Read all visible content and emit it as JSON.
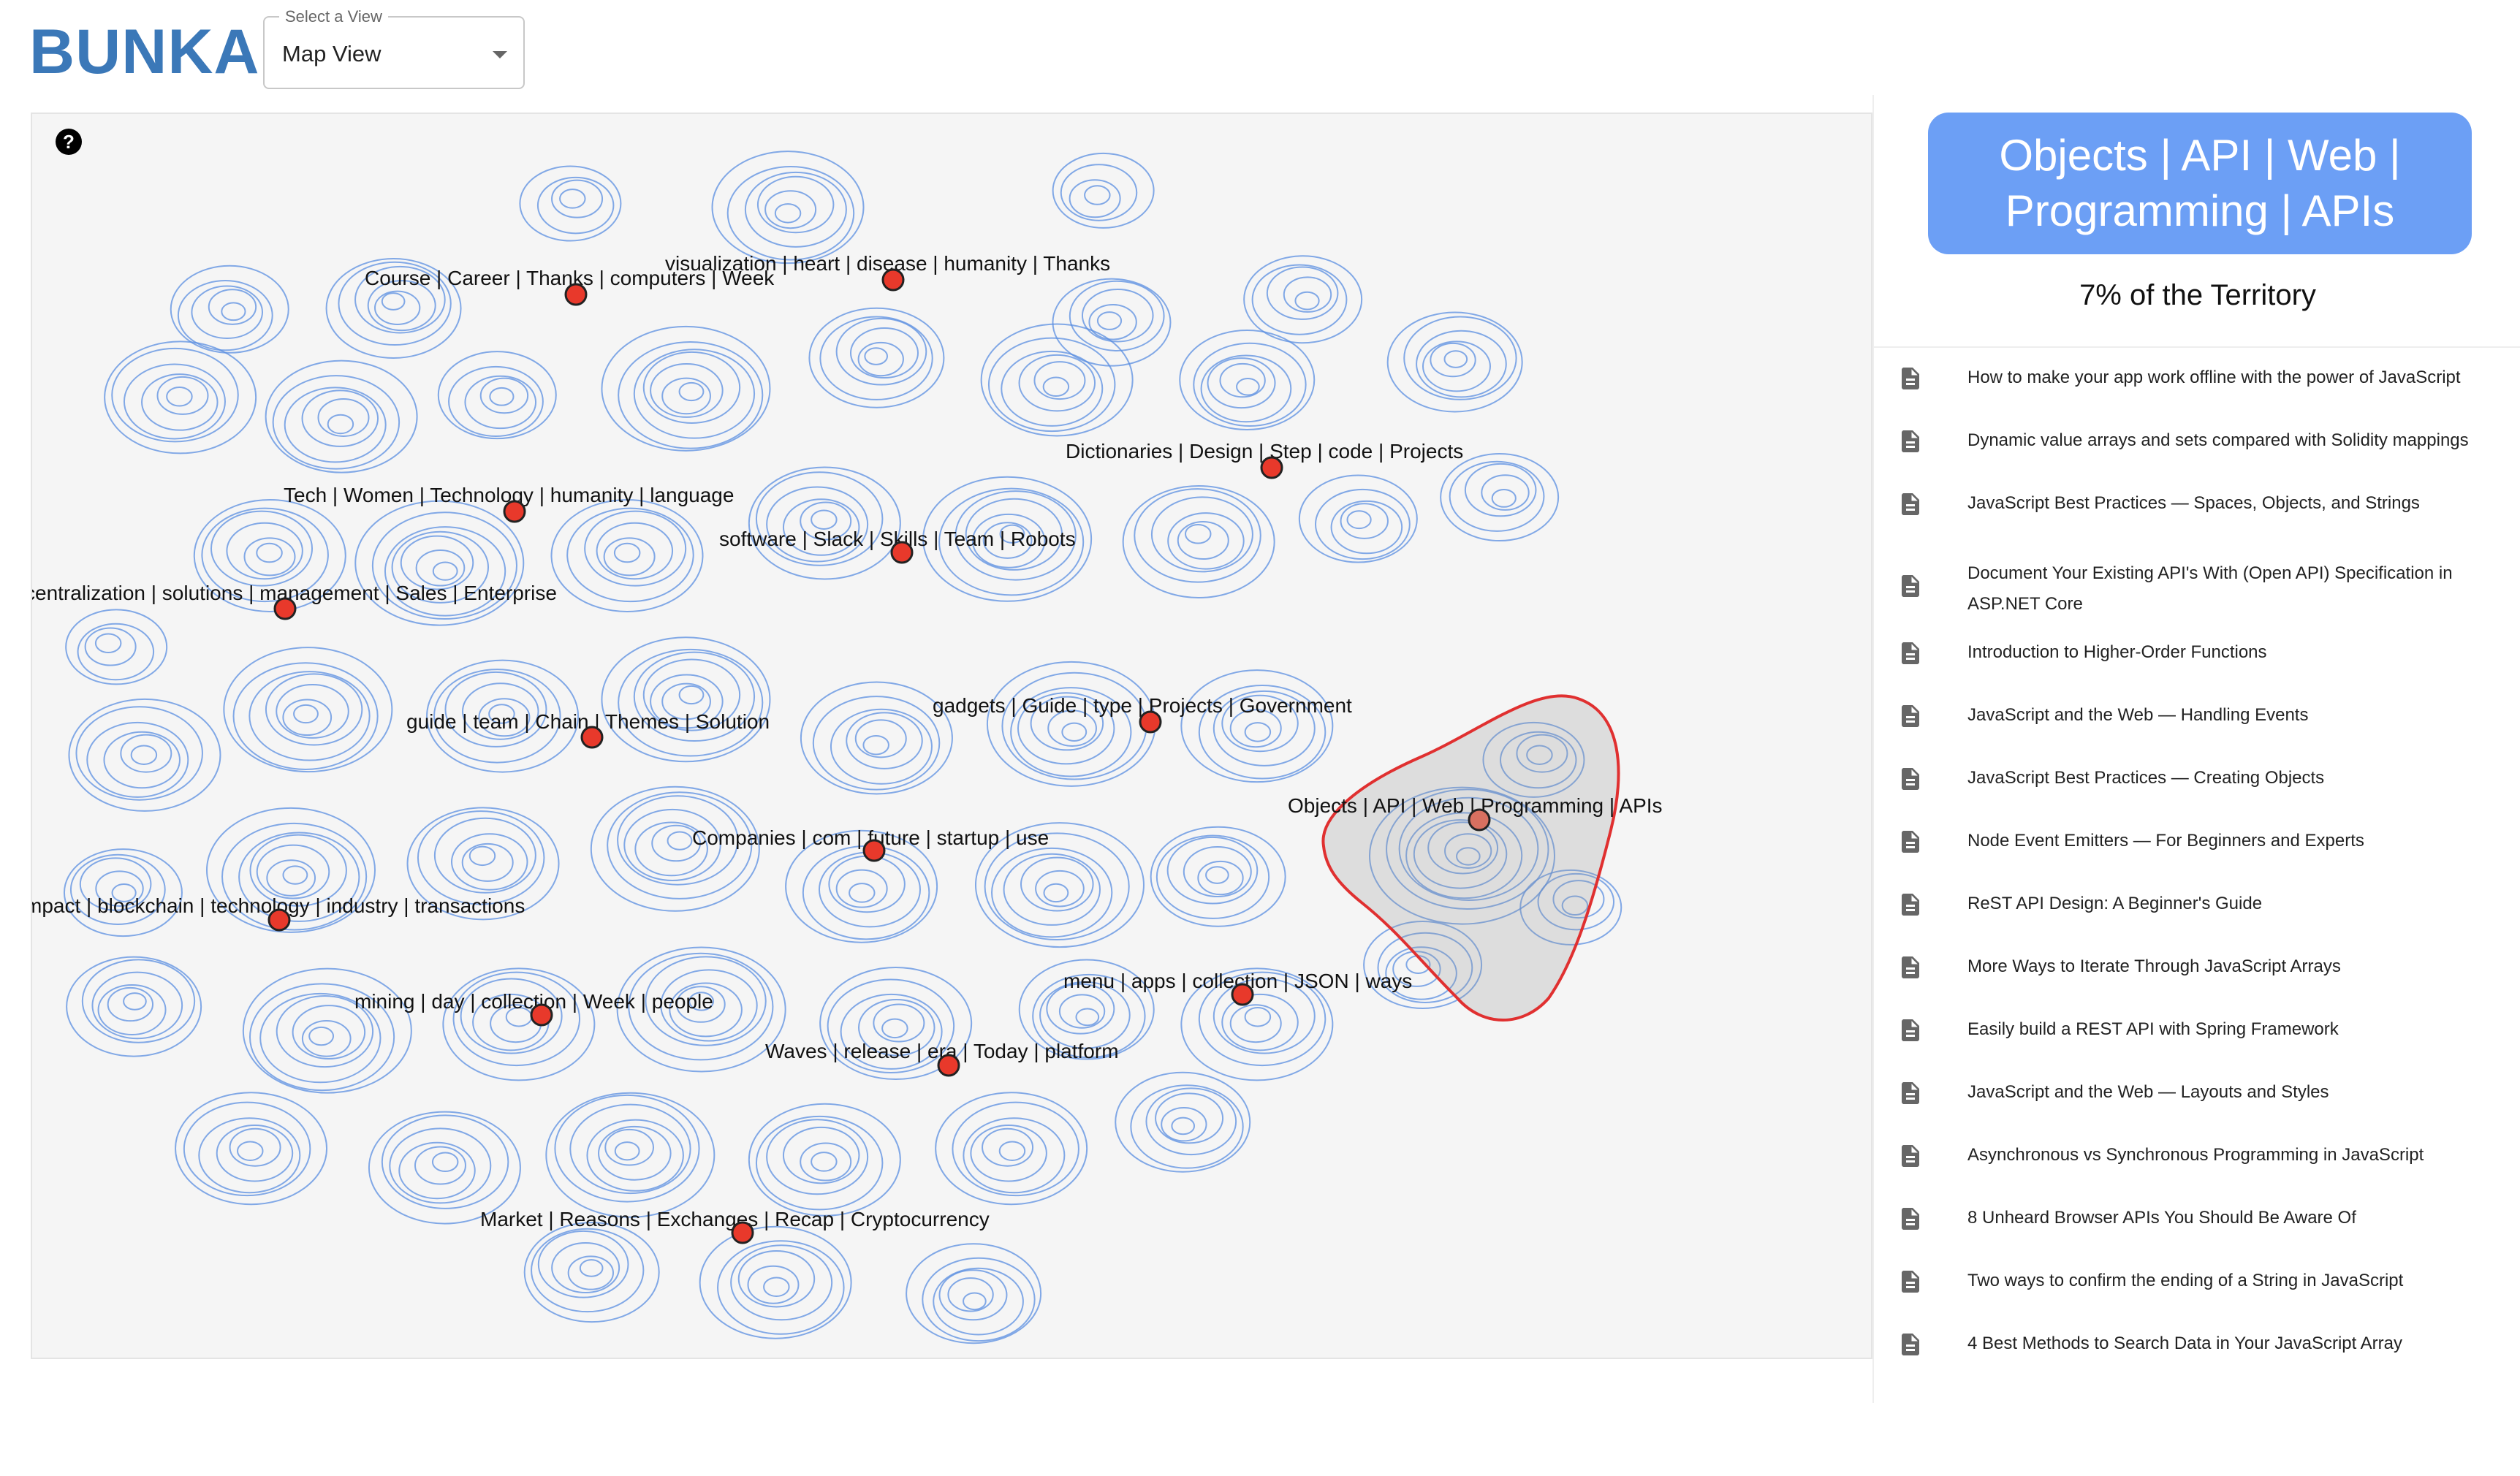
{
  "app": {
    "logo": "BUNKA",
    "view_select": {
      "legend": "Select a View",
      "value": "Map View"
    }
  },
  "map": {
    "help_label": "?",
    "topics": [
      {
        "label": "Course | Career | Thanks | computers | Week"
      },
      {
        "label": "visualization | heart | disease | humanity | Thanks"
      },
      {
        "label": "Dictionaries | Design | Step | code | Projects"
      },
      {
        "label": "Tech | Women | Technology | humanity | language"
      },
      {
        "label": "software | Slack | Skills | Team | Robots"
      },
      {
        "label": "centralization | solutions | management | Sales | Enterprise"
      },
      {
        "label": "guide | team | Chain | Themes | Solution"
      },
      {
        "label": "gadgets | Guide | type | Projects | Government"
      },
      {
        "label": "Objects | API | Web | Programming | APIs"
      },
      {
        "label": "Companies | com | future | startup | use"
      },
      {
        "label": "mpact | blockchain | technology | industry | transactions"
      },
      {
        "label": "mining | day | collection | Week | people"
      },
      {
        "label": "menu | apps | collection | JSON | ways"
      },
      {
        "label": "Waves | release | era | Today | platform"
      },
      {
        "label": "Market | Reasons | Exchanges | Recap | Cryptocurrency"
      }
    ],
    "colors": {
      "contour": "#5a8de0",
      "point": "#e8392b",
      "selection": "#e03030",
      "background": "#f5f5f5"
    }
  },
  "panel": {
    "topic_title": "Objects | API | Web | Programming | APIs",
    "territory": "7% of the Territory",
    "doc_icon": "document-icon",
    "documents": [
      "How to make your app work offline with the power of JavaScript",
      "Dynamic value arrays and sets compared with Solidity mappings",
      "JavaScript Best Practices — Spaces, Objects, and Strings",
      "Document Your Existing API's With (Open API) Specification in ASP.NET Core",
      "Introduction to Higher-Order Functions",
      "JavaScript and the Web — Handling Events",
      "JavaScript Best Practices — Creating Objects",
      "Node Event Emitters — For Beginners and Experts",
      "ReST API Design: A Beginner's Guide",
      "More Ways to Iterate Through JavaScript Arrays",
      "Easily build a REST API with Spring Framework",
      "JavaScript and the Web — Layouts and Styles",
      "Asynchronous vs Synchronous Programming in JavaScript",
      "8 Unheard Browser APIs You Should Be Aware Of",
      "Two ways to confirm the ending of a String in JavaScript",
      "4 Best Methods to Search Data in Your JavaScript Array"
    ]
  }
}
